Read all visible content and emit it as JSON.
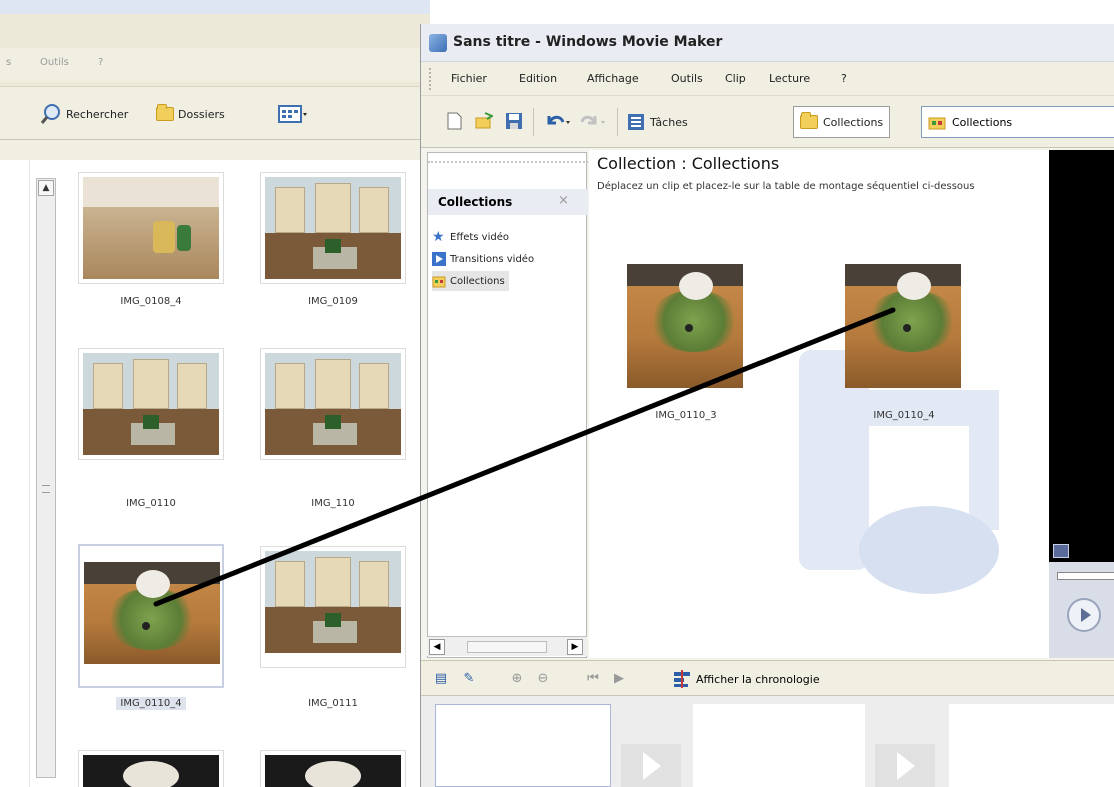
{
  "explorer": {
    "menu_partial_left": "s",
    "menu_tools": "Outils",
    "menu_help": "?",
    "toolbar": {
      "search_label": "Rechercher",
      "folders_label": "Dossiers"
    },
    "thumbnails": [
      {
        "name": "IMG_0108_4"
      },
      {
        "name": "IMG_0109"
      },
      {
        "name": "IMG_0110"
      },
      {
        "name": "IMG_110"
      },
      {
        "name": "IMG_0110_4"
      },
      {
        "name": "IMG_0111"
      }
    ]
  },
  "wmm": {
    "title": "Sans titre - Windows Movie Maker",
    "menu": [
      "Fichier",
      "Edition",
      "Affichage",
      "Outils",
      "Clip",
      "Lecture",
      "?"
    ],
    "toolbar": {
      "tasks_label": "Tâches",
      "collections_label": "Collections",
      "collection_combo_value": "Collections"
    },
    "tasks_pane": {
      "heading": "Collections",
      "close": "×",
      "items": [
        "Effets vidéo",
        "Transitions vidéo",
        "Collections"
      ]
    },
    "content": {
      "title": "Collection : Collections",
      "description": "Déplacez un clip et placez-le sur la table de montage séquentiel ci-dessous",
      "clips": [
        {
          "name": "IMG_0110_3"
        },
        {
          "name": "IMG_0110_4"
        }
      ]
    },
    "timeline_toolbar": {
      "show_timeline_label": "Afficher la chronologie"
    }
  }
}
